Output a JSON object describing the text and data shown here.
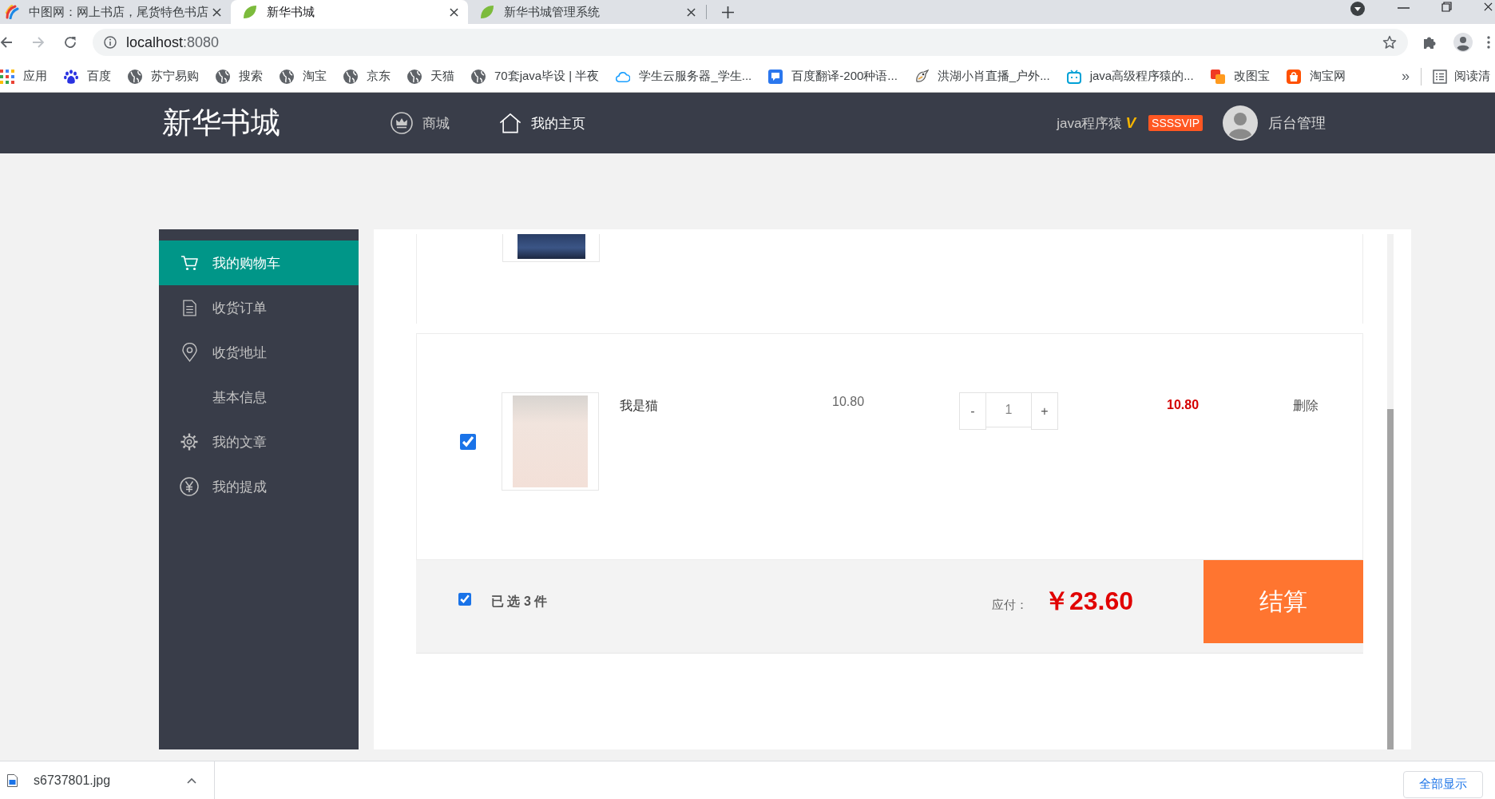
{
  "browser": {
    "tabs": [
      {
        "title": "中图网：网上书店，尾货特色书店",
        "kind": "swirl",
        "selected": false
      },
      {
        "title": "新华书城",
        "kind": "leaf",
        "selected": true
      },
      {
        "title": "新华书城管理系统",
        "kind": "leaf",
        "selected": false
      }
    ],
    "forward": {
      "disabled": true
    },
    "address": {
      "host": "localhost",
      "port": ":8080"
    },
    "bookmarks": [
      {
        "label": "应用",
        "kind": "apps"
      },
      {
        "label": "百度",
        "kind": "paw"
      },
      {
        "label": "苏宁易购",
        "kind": "globe"
      },
      {
        "label": "搜索",
        "kind": "globe"
      },
      {
        "label": "淘宝",
        "kind": "globe"
      },
      {
        "label": "京东",
        "kind": "globe"
      },
      {
        "label": "天猫",
        "kind": "globe"
      },
      {
        "label": "70套java毕设 | 半夜",
        "kind": "globe"
      },
      {
        "label": "学生云服务器_学生...",
        "kind": "cloud"
      },
      {
        "label": "百度翻译-200种语...",
        "kind": "translate"
      },
      {
        "label": "洪湖小肖直播_户外...",
        "kind": "bird"
      },
      {
        "label": "java高级程序猿的...",
        "kind": "tv"
      },
      {
        "label": "改图宝",
        "kind": "squares"
      },
      {
        "label": "淘宝网",
        "kind": "shop"
      }
    ],
    "overflow": "»",
    "reading_list": "阅读清"
  },
  "header": {
    "logo": "新华书城",
    "nav": [
      {
        "label": "商城",
        "kind": "crown",
        "selected": false
      },
      {
        "label": "我的主页",
        "kind": "home",
        "selected": true
      }
    ],
    "user": {
      "name": "java程序猿",
      "mark": "V",
      "badge": "SSSSVIP"
    },
    "admin_link": "后台管理"
  },
  "sidebar": {
    "items": [
      {
        "label": "我的购物车",
        "kind": "cart",
        "selected": true
      },
      {
        "label": "收货订单",
        "kind": "document",
        "selected": false
      },
      {
        "label": "收货地址",
        "kind": "pin",
        "selected": false
      },
      {
        "label": "基本信息",
        "kind": "none",
        "selected": false
      },
      {
        "label": "我的文章",
        "kind": "gear",
        "selected": false
      },
      {
        "label": "我的提成",
        "kind": "yen",
        "selected": false
      }
    ]
  },
  "cart": {
    "items": [
      {
        "kind": "clipped"
      },
      {
        "kind": "full",
        "checked": true,
        "title": "我是猫",
        "price": "10.80",
        "decrement": "-",
        "quantity": "1",
        "increment": "+",
        "subtotal": "10.80",
        "action": "删除"
      }
    ],
    "footer": {
      "all_checked": true,
      "selected_count": "已 选 3 件",
      "due_label": "应付：",
      "total": "￥23.60",
      "checkout": "结算"
    }
  },
  "downloads": {
    "file": "s6737801.jpg",
    "show_all": "全部显示"
  }
}
